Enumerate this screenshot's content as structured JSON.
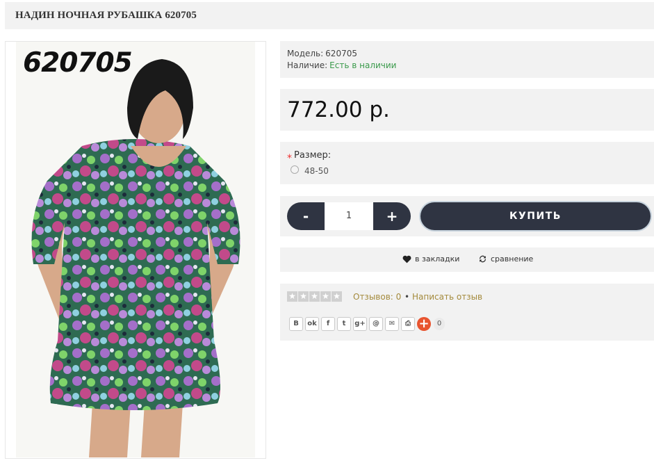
{
  "product": {
    "title": "НАДИН НОЧНАЯ РУБАШКА 620705",
    "image_code": "620705"
  },
  "info": {
    "model_label": "Модель:",
    "model_value": "620705",
    "stock_label": "Наличие:",
    "stock_value": "Есть в наличии",
    "stock_color": "#3a9a4b"
  },
  "price": "772.00 р.",
  "options": {
    "required_mark": "*",
    "size_label": "Размер:",
    "size_option": "48-50"
  },
  "cart": {
    "minus_label": "-",
    "quantity": "1",
    "plus_label": "+",
    "buy_label": "КУПИТЬ"
  },
  "actions": {
    "wishlist_label": "в закладки",
    "compare_label": "сравнение"
  },
  "reviews": {
    "rating": 0,
    "max_rating": 5,
    "count_label": "Отзывов: 0",
    "separator": "•",
    "write_label": "Написать отзыв"
  },
  "share": {
    "buttons": [
      "vk-icon",
      "odnoklassniki-icon",
      "facebook-icon",
      "twitter-icon",
      "google-plus-icon",
      "mailru-icon",
      "email-icon",
      "print-icon"
    ],
    "counter": "0"
  },
  "colors": {
    "dark_button": "#2f3442",
    "panel_bg": "#f2f2f2",
    "link_gold": "#a48a3c",
    "share_plus": "#e8542f"
  }
}
